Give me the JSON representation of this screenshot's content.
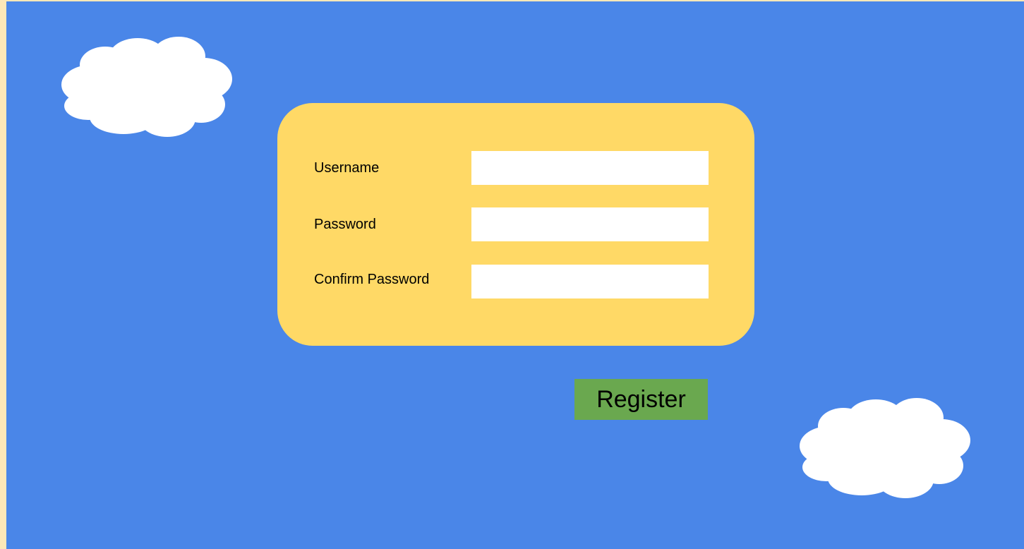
{
  "form": {
    "username_label": "Username",
    "username_value": "",
    "password_label": "Password",
    "password_value": "",
    "confirm_password_label": "Confirm Password",
    "confirm_password_value": ""
  },
  "actions": {
    "register_label": "Register"
  },
  "colors": {
    "page_border": "#fde8b8",
    "sky": "#4a86e8",
    "card": "#ffd966",
    "input": "#ffffff",
    "register_button": "#6aa84f",
    "cloud": "#ffffff"
  },
  "decorations": {
    "clouds": [
      "cloud",
      "cloud"
    ]
  }
}
